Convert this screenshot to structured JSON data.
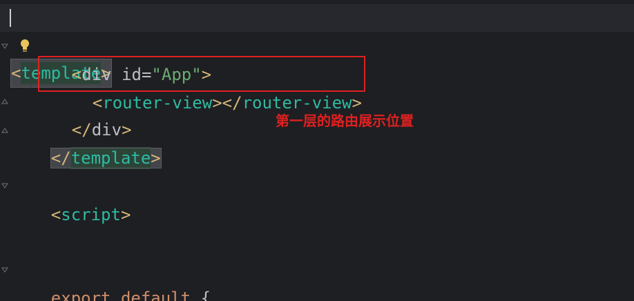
{
  "code": {
    "line1": {
      "open": "<",
      "tag": "template",
      "close": ">"
    },
    "line2": {
      "open": "<",
      "tag": "div",
      "space": " ",
      "attr": "id",
      "eq": "=",
      "val": "\"App\"",
      "close": ">"
    },
    "line3": {
      "open1": "<",
      "tag1": "router-view",
      "close1": ">",
      "open2": "</",
      "tag2": "router-view",
      "close2": ">"
    },
    "line4": {
      "open": "</",
      "tag": "div",
      "close": ">"
    },
    "line5": {
      "open": "</",
      "tag": "template",
      "close": ">"
    },
    "line6": {
      "open": "<",
      "tag": "script",
      "close": ">"
    },
    "line7": {
      "kw1": "export",
      "sp1": " ",
      "kw2": "default",
      "sp2": " ",
      "brace": "{"
    }
  },
  "annotation": {
    "text": "第一层的路由展示位置",
    "color": "#e02020"
  },
  "icons": {
    "bulb": "lightbulb-icon",
    "fold": "fold-marker-icon"
  }
}
